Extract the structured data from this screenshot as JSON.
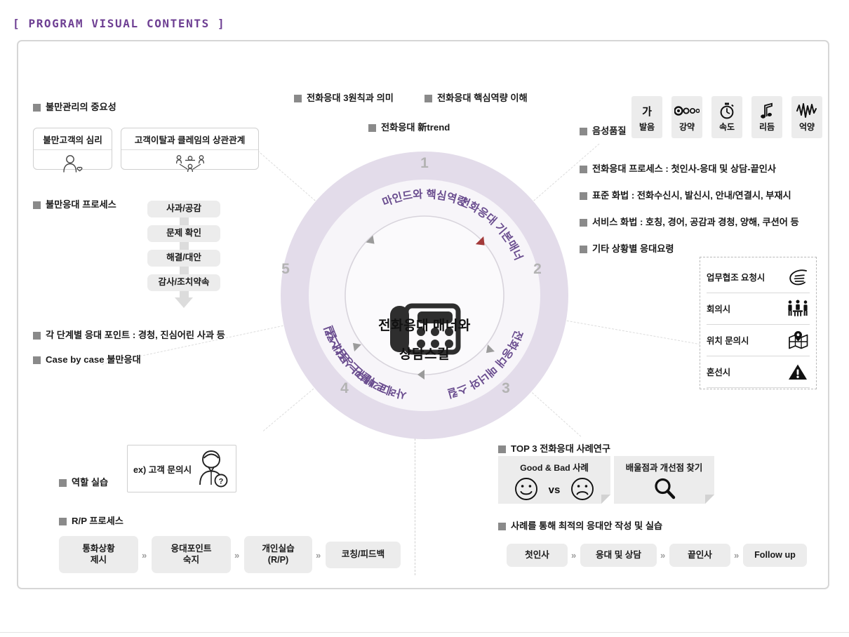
{
  "page": {
    "title": "[ PROGRAM VISUAL CONTENTS ]",
    "title_color": "#6e3f93",
    "frame_border_color": "#d6d6d6",
    "bullet_square_color": "#8a8a8a"
  },
  "center": {
    "core_line1": "전화응대 매너와",
    "core_line2": "상담스킬",
    "phone_icon": "desk-phone-icon",
    "marker_icon": "red-triangle-marker",
    "marker_color": "#a33a3a",
    "ring_color": "#e3dcea",
    "inner_ring_color": "#f5f2f7",
    "arc_label_color": "#6a4d8f",
    "segments": [
      {
        "number": "1",
        "label": "마인드와 핵심역량"
      },
      {
        "number": "2",
        "label": "전화응대 기본매너"
      },
      {
        "number": "3",
        "label": "전화응대 매너와 스킬"
      },
      {
        "number": "4",
        "label": "사례로 배우는 응대스킬"
      },
      {
        "number": "5",
        "label": "고객불만 상담스킬"
      }
    ]
  },
  "top_left": {
    "heading": "불만관리의 중요성",
    "cards": [
      {
        "title": "불만고객의 심리",
        "icon": "person-heart-icon"
      },
      {
        "title": "고객이탈과 클레임의 상관관계",
        "icon": "people-group-icon"
      }
    ]
  },
  "mid_left": {
    "heading": "불만응대 프로세스",
    "steps": [
      "사과/공감",
      "문제 확인",
      "해결/대안",
      "감사/조치약속"
    ],
    "notes": [
      "각 단계별 응대 포인트 : 경청, 진심어린 사과 등",
      "Case by case 불만응대"
    ]
  },
  "top_center": {
    "headings": [
      "전화응대 3원칙과 의미",
      "전화응대 핵심역량 이해",
      "전화응대 新trend"
    ]
  },
  "right": {
    "voice_quality_heading": "음성품질",
    "voice_quality_chips": [
      {
        "label": "발음",
        "icon": "hangul-ga-icon",
        "glyph": "가"
      },
      {
        "label": "강약",
        "icon": "volume-dots-icon",
        "glyph": "●∘∘"
      },
      {
        "label": "속도",
        "icon": "stopwatch-icon",
        "glyph": "⏱"
      },
      {
        "label": "리듬",
        "icon": "music-note-icon",
        "glyph": "♬"
      },
      {
        "label": "억양",
        "icon": "waveform-icon",
        "glyph": "∿"
      }
    ],
    "bullets": [
      "전화응대 프로세스 : 첫인사-응대 및 상담-끝인사",
      "표준 화법 : 전화수신시, 발신시, 안내/연결시, 부재시",
      "서비스 화법 : 호칭, 경어, 공감과 경청, 양해, 쿠션어 등",
      "기타 상황별 응대요령"
    ],
    "situations": [
      {
        "label": "업무협조 요청시",
        "icon": "hand-gesture-icon"
      },
      {
        "label": "회의시",
        "icon": "meeting-people-icon"
      },
      {
        "label": "위치 문의시",
        "icon": "map-pin-icon"
      },
      {
        "label": "혼선시",
        "icon": "warning-triangle-icon"
      }
    ]
  },
  "bottom_left": {
    "roleplay_heading": "역할 실습",
    "example_box": {
      "text": "ex) 고객 문의시",
      "icon": "customer-question-icon"
    },
    "process_heading": "R/P 프로세스",
    "steps": [
      {
        "line1": "통화상황",
        "line2": "제시"
      },
      {
        "line1": "응대포인트",
        "line2": "숙지"
      },
      {
        "line1": "개인실습",
        "line2": "(R/P)"
      },
      {
        "line1": "코칭/피드백",
        "line2": ""
      }
    ],
    "connector": "»"
  },
  "bottom_right": {
    "case_heading": "TOP 3 전화응대 사례연구",
    "case_boxes": [
      {
        "title": "Good & Bad 사례",
        "icon": "smile-vs-frown-icon",
        "vs_text": "vs"
      },
      {
        "title": "배울점과 개선점 찾기",
        "icon": "magnifier-icon"
      }
    ],
    "practice_heading": "사례를 통해 최적의 응대안 작성 및 실습",
    "steps": [
      "첫인사",
      "응대 및 상담",
      "끝인사",
      "Follow up"
    ],
    "connector": "»"
  }
}
